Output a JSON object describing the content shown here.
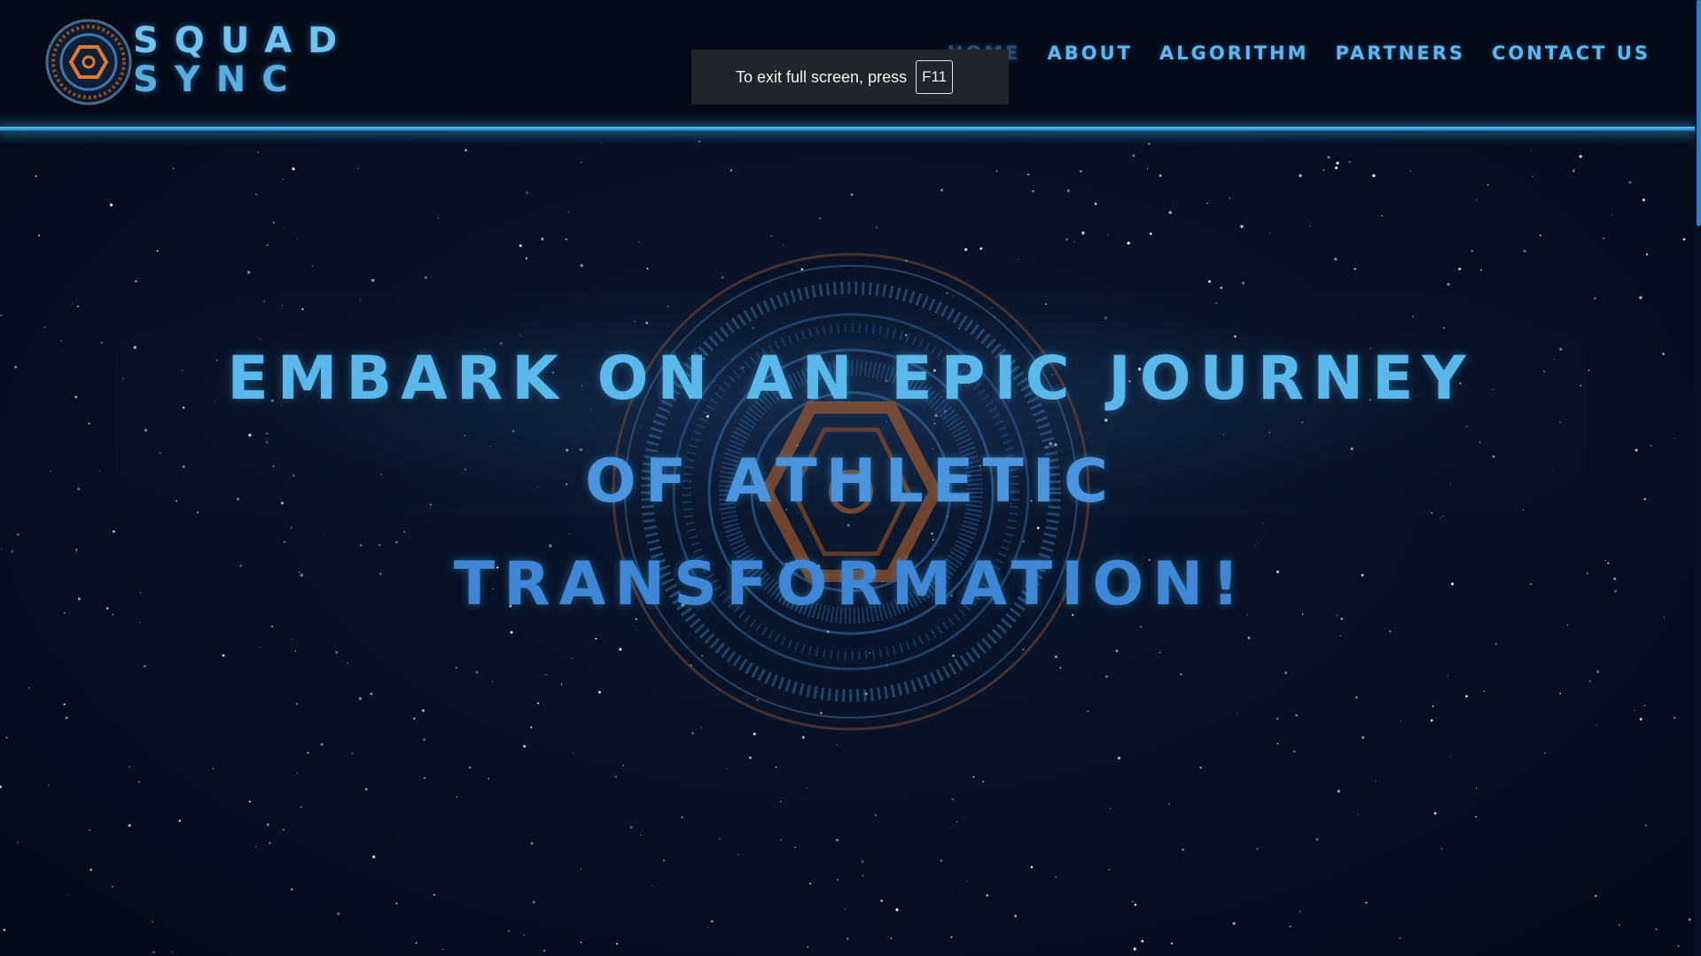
{
  "brand": {
    "line1": "SQUAD",
    "line2": "SYNC"
  },
  "nav": {
    "items": [
      {
        "label": "Home"
      },
      {
        "label": "About"
      },
      {
        "label": "Algorithm"
      },
      {
        "label": "Partners"
      },
      {
        "label": "Contact Us"
      }
    ]
  },
  "toast": {
    "text": "To exit full screen, press",
    "key": "F11"
  },
  "hero": {
    "line1": "Embark on an epic journey",
    "line2": "of athletic",
    "line3": "transformation!"
  },
  "colors": {
    "accent": "#5fb6ec",
    "background": "#050b1a",
    "emblem_orange": "#c2672b"
  }
}
